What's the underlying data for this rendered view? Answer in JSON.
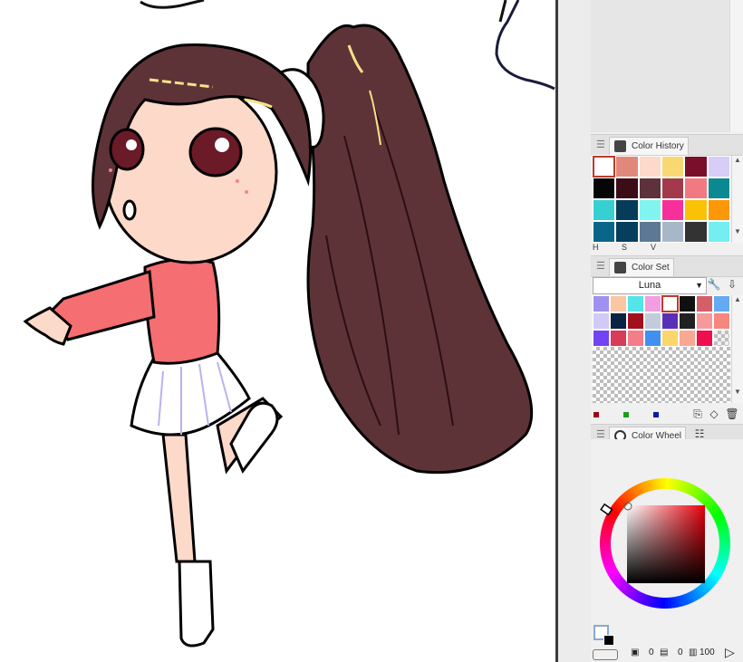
{
  "panels": {
    "color_history": {
      "title": "Color History",
      "colors": [
        "#ffffff",
        "#e0897a",
        "#fcd9c9",
        "#f9d873",
        "#7a0f2b",
        "#d7cdf6",
        "#060606",
        "#3c0c17",
        "#5e323b",
        "#a23a4b",
        "#f17a82",
        "#0b8993",
        "#36d0d2",
        "#063c5a",
        "#80f5ef",
        "#f72f9b",
        "#fbc105",
        "#fc9808",
        "#0a6688",
        "#063e5e",
        "#5d7894",
        "#a8b7c8",
        "#333333",
        "#74eef0"
      ],
      "selected_index": 0,
      "mode_labels": [
        "H",
        "S",
        "V"
      ]
    },
    "color_set": {
      "title": "Color Set",
      "set_name": "Luna",
      "colors": [
        "#a090f0",
        "#fbc6a2",
        "#55e4ea",
        "#f49de0",
        "#ffffff",
        "#101010",
        "#d55f69",
        "#63aaf3",
        "#d3c9f6",
        "#0a2344",
        "#a2101c",
        "#c3ccdb",
        "#5a2fb7",
        "#212121",
        "#f59a98",
        "#f6877f",
        "#7143f2",
        "#d93c56",
        "#f47d8a",
        "#4190ef",
        "#fbd66a",
        "#f9a892",
        "#ef0f4f",
        ""
      ],
      "selected_index": 4,
      "palette_indicators": [
        "#a0001a",
        "#1aa01a",
        "#0a1aa8"
      ]
    },
    "color_wheel": {
      "title": "Color Wheel",
      "hue": 0,
      "main_color": "#ffffff",
      "sub_color": "#000000",
      "values": [
        "0",
        "0",
        "100"
      ]
    }
  }
}
